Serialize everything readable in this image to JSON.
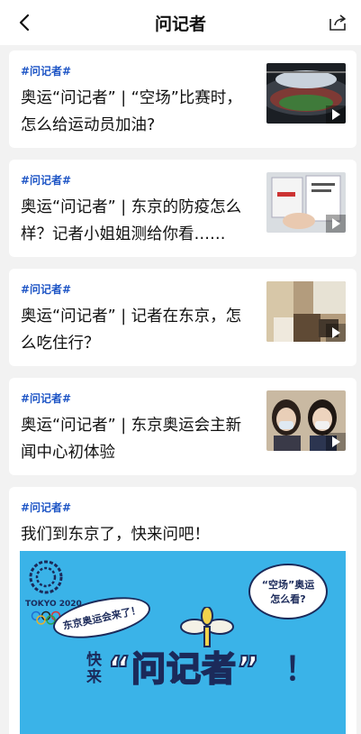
{
  "nav": {
    "title": "问记者",
    "back_icon": "chevron-left-icon",
    "share_icon": "share-icon"
  },
  "articles": [
    {
      "tag": "#问记者#",
      "title": "奥运“问记者” | “空场”比赛时，怎么给运动员加油?"
    },
    {
      "tag": "#问记者#",
      "title": "奥运“问记者” | 东京的防疫怎么样？记者小姐姐测给你看……"
    },
    {
      "tag": "#问记者#",
      "title": "奥运“问记者” | 记者在东京，怎么吃住行？"
    },
    {
      "tag": "#问记者#",
      "title": "奥运“问记者” | 东京奥运会主新闻中心初体验"
    }
  ],
  "featured": {
    "tag": "#问记者#",
    "title": "我们到东京了，快来问吧！",
    "banner": {
      "bg_color": "#3ab3e8",
      "logo_text": "TOKYO 2020",
      "left_bubble": "东京奥运会来了！",
      "right_bubble": "“空场”奥运怎么看?",
      "kuai_lai": "快来",
      "main_text": "“问记者”",
      "exclaim": "！"
    }
  },
  "colors": {
    "tag": "#1f56c6",
    "text": "#111111",
    "background": "#f2f2f2"
  }
}
